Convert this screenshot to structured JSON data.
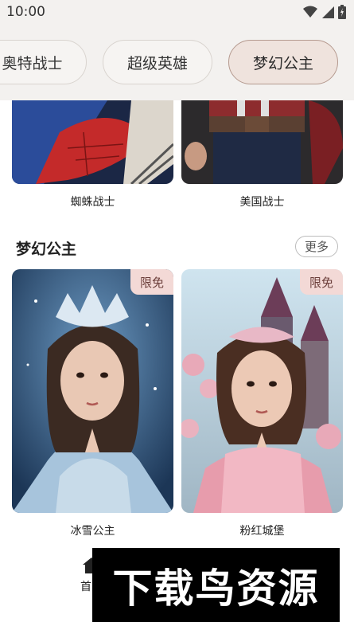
{
  "status_bar": {
    "time": "10:00"
  },
  "tabs": [
    {
      "label": "奥特战士",
      "active": false
    },
    {
      "label": "超级英雄",
      "active": false
    },
    {
      "label": "梦幻公主",
      "active": true
    }
  ],
  "top_cards": [
    {
      "title": "蜘蛛战士"
    },
    {
      "title": "美国战士"
    }
  ],
  "section": {
    "title": "梦幻公主",
    "more_label": "更多",
    "cards": [
      {
        "title": "冰雪公主",
        "badge": "限免"
      },
      {
        "title": "粉红城堡",
        "badge": "限免"
      }
    ]
  },
  "bottom_nav": {
    "home_label": "首页"
  },
  "watermark": {
    "text": "下载鸟资源"
  },
  "colors": {
    "accent_border": "#b59a8f",
    "badge_bg": "#f3d9d6",
    "tabs_bg": "#f3f1ef"
  }
}
